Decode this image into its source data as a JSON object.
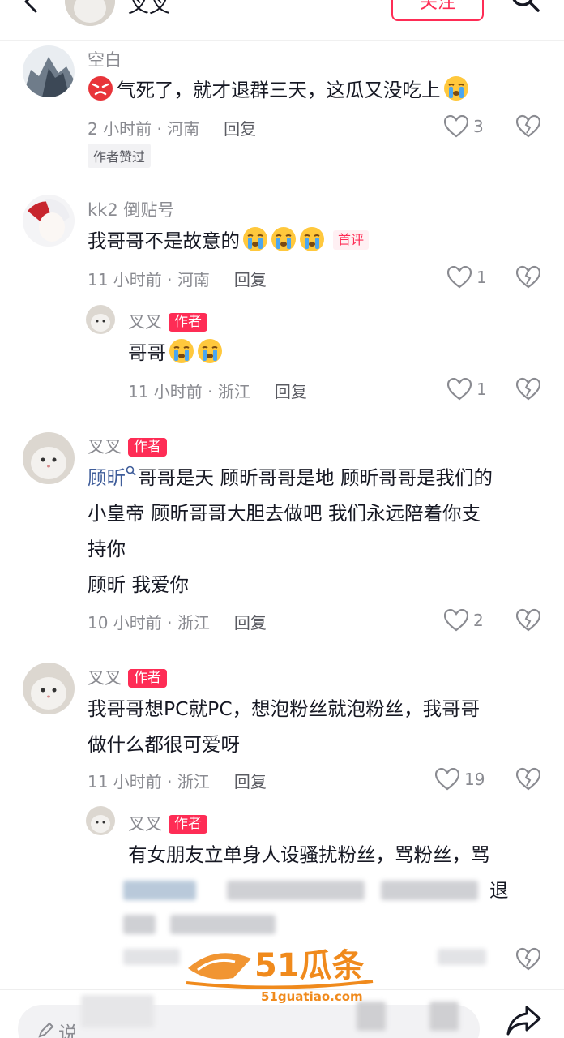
{
  "header": {
    "name": "叉叉",
    "follow_label": "关注"
  },
  "comments": [
    {
      "user": "空白",
      "text_parts": {
        "before": "",
        "main": "气死了，就才退群三天，这瓜又没吃上"
      },
      "time_location": "2 小时前 · 河南",
      "reply": "回复",
      "likes": "3",
      "badge": "作者赞过"
    },
    {
      "user": "kk2 倒贴号",
      "text": "我哥哥不是故意的",
      "first_tag": "首评",
      "time_location": "11 小时前 · 河南",
      "reply": "回复",
      "likes": "1",
      "sub": {
        "user": "叉叉",
        "author_tag": "作者",
        "text": "哥哥",
        "time_location": "11 小时前 · 浙江",
        "reply": "回复",
        "likes": "1"
      }
    },
    {
      "user": "叉叉",
      "author_tag": "作者",
      "mention": "顾昕",
      "line1": "哥哥是天 顾昕哥哥是地 顾昕哥哥是我们的",
      "line2": "小皇帝 顾昕哥哥大胆去做吧 我们永远陪着你支",
      "line3": "持你",
      "line4": "顾昕 我爱你",
      "time_location": "10 小时前 · 浙江",
      "reply": "回复",
      "likes": "2"
    },
    {
      "user": "叉叉",
      "author_tag": "作者",
      "line1": "我哥哥想PC就PC，想泡粉丝就泡粉丝，我哥哥",
      "line2": "做什么都很可爱呀",
      "time_location": "11 小时前 · 浙江",
      "reply": "回复",
      "likes": "19",
      "sub": {
        "user": "叉叉",
        "author_tag": "作者",
        "line1": "有女朋友立单身人设骚扰粉丝，骂粉丝，骂",
        "line2_tail": "退"
      }
    }
  ],
  "watermark": {
    "brand": "51瓜条",
    "url": "51guatiao.com"
  },
  "bottom": {
    "input_placeholder": "说"
  },
  "colors": {
    "accent": "#fe2c55",
    "link": "#3f5d9a",
    "muted": "#8a8b91"
  }
}
